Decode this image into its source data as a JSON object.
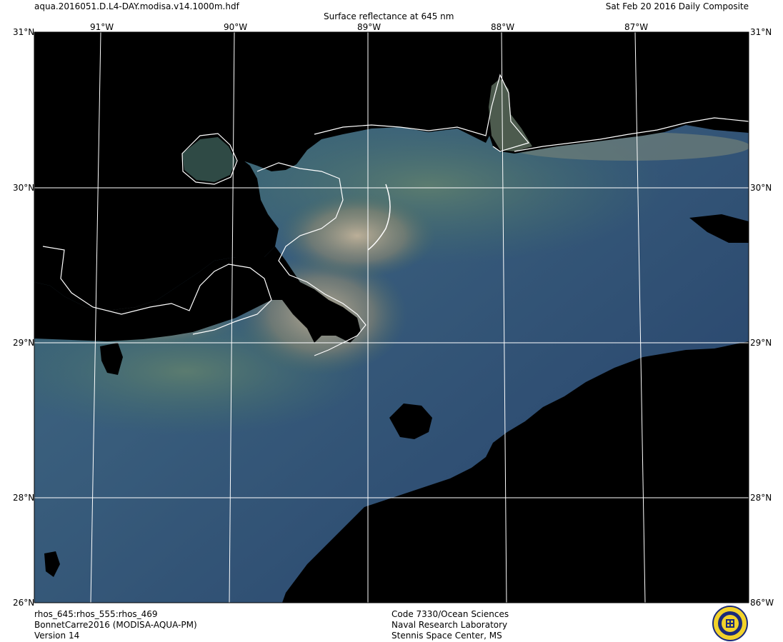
{
  "header": {
    "filename": "aqua.2016051.D.L4-DAY.modisa.v14.1000m.hdf",
    "title": "Surface reflectance at 645 nm",
    "date": "Sat Feb 20 2016 Daily Composite"
  },
  "map": {
    "lon_ticks": [
      "91°W",
      "90°W",
      "89°W",
      "88°W",
      "87°W"
    ],
    "lat_ticks": [
      "31°N",
      "30°N",
      "29°N",
      "28°N"
    ],
    "corner_labels": {
      "top_left": "31°N",
      "top_right": "31°N",
      "bottom_left": "26°N",
      "bottom_right": "86°W"
    },
    "colors": {
      "land": "#000000",
      "coast": "#ffffff",
      "grid": "#ffffff",
      "deep_water": "#25406a",
      "mid_water": "#3a5f7d",
      "shelf_water": "#3f6f6a",
      "sediment_plume": "#b7a990"
    }
  },
  "footer": {
    "left": [
      "rhos_645:rhos_555:rhos_469",
      "BonnetCarre2016 (MODISA-AQUA-PM)",
      "Version 14"
    ],
    "center": [
      "Code 7330/Ocean Sciences",
      "Naval Research Laboratory",
      "Stennis Space Center, MS"
    ],
    "logo_icon": "nrl-seal-icon"
  }
}
